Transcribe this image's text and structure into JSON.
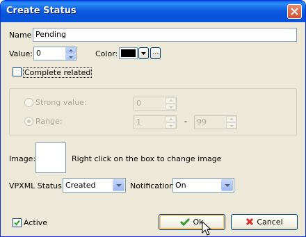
{
  "window": {
    "title": "Create Status"
  },
  "form": {
    "name_label": "Name",
    "name_value": "Pending",
    "value_label": "Value:",
    "value_value": "0",
    "color_label": "Color:",
    "color_value": "#000000",
    "more_colors_label": "...",
    "complete_related_label": "Complete related",
    "complete_related_checked": false
  },
  "group": {
    "strong_value_label": "Strong value:",
    "strong_value_value": "0",
    "range_label": "Range:",
    "range_from": "1",
    "range_separator": "-",
    "range_to": "99"
  },
  "image": {
    "label": "Image:",
    "hint": "Right click on the box to  change image"
  },
  "vpxml": {
    "status_label": "VPXML Status:",
    "status_value": "Created",
    "notification_label": "Notification:",
    "notification_value": "On"
  },
  "footer": {
    "active_label": "Active",
    "active_checked": true,
    "ok_label": "Ok",
    "cancel_label": "Cancel"
  },
  "colors": {
    "titlebar": "#0a5ee8",
    "ok_check": "#2e9a2e",
    "cancel_x": "#d62b2b"
  }
}
